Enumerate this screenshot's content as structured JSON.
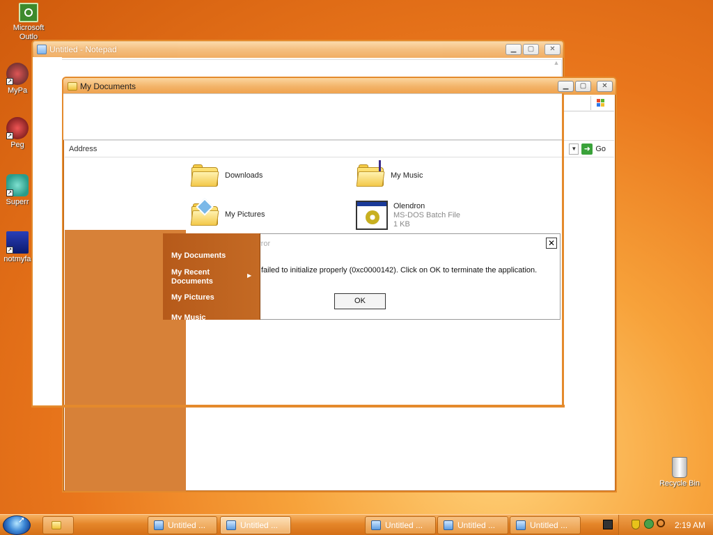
{
  "desktop": {
    "icons": [
      {
        "label": "Microsoft Outlo",
        "icon": "outlook-icon"
      },
      {
        "label": "MyPa",
        "icon": "app-shortcut-icon"
      },
      {
        "label": "Peg",
        "icon": "app-shortcut-icon"
      },
      {
        "label": "Superr",
        "icon": "app-shortcut-icon"
      },
      {
        "label": "notmyfa",
        "icon": "app-shortcut-icon"
      },
      {
        "label": "Recycle Bin",
        "icon": "recycle-bin-icon"
      }
    ]
  },
  "notepad": {
    "title": "Untitled - Notepad"
  },
  "explorer": {
    "title": "My Documents",
    "address_label": "Address",
    "go_label": "Go",
    "items": [
      {
        "name": "Downloads",
        "icon": "folder-icon"
      },
      {
        "name": "My Music",
        "icon": "music-folder-icon"
      },
      {
        "name": "My Pictures",
        "icon": "pictures-folder-icon"
      },
      {
        "name": "Olendron",
        "type": "MS-DOS Batch File",
        "size": "1 KB",
        "icon": "batch-file-icon"
      }
    ]
  },
  "start_menu": {
    "items": [
      "My Documents",
      "My Recent Documents",
      "My Pictures",
      "My Music"
    ]
  },
  "error_dialog": {
    "title_fragment": "rror",
    "message": "failed to initialize properly (0xc0000142). Click on OK to terminate the application.",
    "ok_label": "OK",
    "close_glyph": "✕"
  },
  "taskbar": {
    "buttons": [
      {
        "label": "Untitled ..."
      },
      {
        "label": "Untitled ...",
        "active": true
      },
      {
        "label": "Untitled ..."
      },
      {
        "label": "Untitled ..."
      },
      {
        "label": "Untitled ..."
      }
    ],
    "clock": "2:19 AM"
  },
  "colors": {
    "accent": "#e48a2c",
    "start_menu_bg": "#b65a1a",
    "explorer_side_panel": "#d78138"
  }
}
